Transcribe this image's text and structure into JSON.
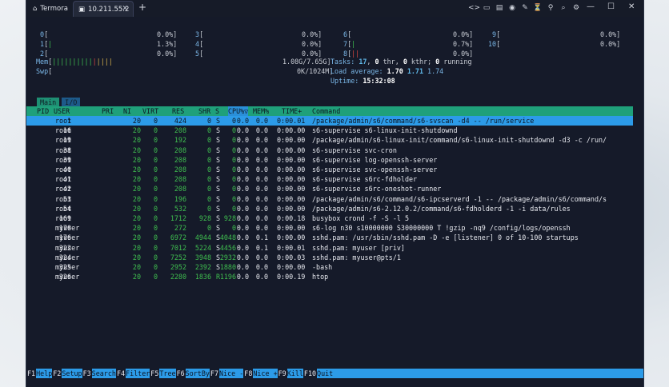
{
  "titlebar": {
    "home_tab": "Termora",
    "active_tab": "10.211.55.2",
    "new_tab": "+",
    "icons": [
      "code-icon",
      "folder-icon",
      "clipboard-icon",
      "record-icon",
      "pen-icon",
      "filter-icon",
      "network-icon",
      "zoom-icon",
      "settings-icon"
    ],
    "icon_glyphs": [
      "<>",
      "▭",
      "▤",
      "◉",
      "✎",
      "⏳",
      "⚲",
      "⌕",
      "⚙"
    ],
    "minimize": "—",
    "maximize": "☐",
    "close": "✕"
  },
  "cpus": [
    {
      "id": "0",
      "pct": "0.0%"
    },
    {
      "id": "1",
      "pct": "1.3%",
      "bar": "|"
    },
    {
      "id": "2",
      "pct": "0.0%"
    },
    {
      "id": "3",
      "pct": "0.0%"
    },
    {
      "id": "4",
      "pct": "0.0%"
    },
    {
      "id": "5",
      "pct": "0.0%"
    },
    {
      "id": "6",
      "pct": "0.0%"
    },
    {
      "id": "7",
      "pct": "0.7%",
      "bar": "|"
    },
    {
      "id": "8",
      "pct": "0.0%",
      "bar": "||"
    },
    {
      "id": "9",
      "pct": "0.0%"
    },
    {
      "id": "10",
      "pct": "0.0%"
    }
  ],
  "mem": {
    "label": "Mem",
    "bar_green": "||||||||||",
    "bar_red": "|",
    "bar_yellow": "||||",
    "value": "1.08G/7.65G"
  },
  "swp": {
    "label": "Swp",
    "value": "0K/1024M"
  },
  "tasks": {
    "label": "Tasks:",
    "count": "17",
    "thr": "0",
    "thr_label": "thr,",
    "kthr": "0",
    "kthr_label": "kthr;",
    "running": "0",
    "running_label": "running"
  },
  "load": {
    "label": "Load average:",
    "l1": "1.70",
    "l5": "1.71",
    "l15": "1.74"
  },
  "uptime": {
    "label": "Uptime:",
    "value": "15:32:08"
  },
  "screen_tabs": [
    "Main",
    "I/O"
  ],
  "columns": [
    "PID",
    "USER",
    "PRI",
    "NI",
    "VIRT",
    "RES",
    "SHR",
    "S",
    "CPU%▽",
    "MEM%",
    "TIME+",
    "Command"
  ],
  "processes": [
    {
      "pid": "1",
      "user": "root",
      "pri": "20",
      "ni": "0",
      "virt": "424",
      "res": "0",
      "shr": "0",
      "s": "S",
      "cpu": "0.0",
      "mem": "0.0",
      "time": "0:00.01",
      "cmd": "/package/admin/s6/command/s6-svscan -d4 -- /run/service"
    },
    {
      "pid": "16",
      "user": "root",
      "pri": "20",
      "ni": "0",
      "virt": "208",
      "res": "0",
      "shr": "0",
      "s": "S",
      "cpu": "0.0",
      "mem": "0.0",
      "time": "0:00.00",
      "cmd": "s6-supervise s6-linux-init-shutdownd"
    },
    {
      "pid": "19",
      "user": "root",
      "pri": "20",
      "ni": "0",
      "virt": "192",
      "res": "0",
      "shr": "0",
      "s": "S",
      "cpu": "0.0",
      "mem": "0.0",
      "time": "0:00.00",
      "cmd": "/package/admin/s6-linux-init/command/s6-linux-init-shutdownd -d3 -c /run/"
    },
    {
      "pid": "38",
      "user": "root",
      "pri": "20",
      "ni": "0",
      "virt": "208",
      "res": "0",
      "shr": "0",
      "s": "S",
      "cpu": "0.0",
      "mem": "0.0",
      "time": "0:00.00",
      "cmd": "s6-supervise svc-cron"
    },
    {
      "pid": "39",
      "user": "root",
      "pri": "20",
      "ni": "0",
      "virt": "208",
      "res": "0",
      "shr": "0",
      "s": "S",
      "cpu": "0.0",
      "mem": "0.0",
      "time": "0:00.00",
      "cmd": "s6-supervise log-openssh-server"
    },
    {
      "pid": "40",
      "user": "root",
      "pri": "20",
      "ni": "0",
      "virt": "208",
      "res": "0",
      "shr": "0",
      "s": "S",
      "cpu": "0.0",
      "mem": "0.0",
      "time": "0:00.00",
      "cmd": "s6-supervise svc-openssh-server"
    },
    {
      "pid": "41",
      "user": "root",
      "pri": "20",
      "ni": "0",
      "virt": "208",
      "res": "0",
      "shr": "0",
      "s": "S",
      "cpu": "0.0",
      "mem": "0.0",
      "time": "0:00.00",
      "cmd": "s6-supervise s6rc-fdholder"
    },
    {
      "pid": "42",
      "user": "root",
      "pri": "20",
      "ni": "0",
      "virt": "208",
      "res": "0",
      "shr": "0",
      "s": "S",
      "cpu": "0.0",
      "mem": "0.0",
      "time": "0:00.00",
      "cmd": "s6-supervise s6rc-oneshot-runner"
    },
    {
      "pid": "53",
      "user": "root",
      "pri": "20",
      "ni": "0",
      "virt": "196",
      "res": "0",
      "shr": "0",
      "s": "S",
      "cpu": "0.0",
      "mem": "0.0",
      "time": "0:00.00",
      "cmd": "/package/admin/s6/command/s6-ipcserverd -1 -- /package/admin/s6/command/s"
    },
    {
      "pid": "54",
      "user": "root",
      "pri": "20",
      "ni": "0",
      "virt": "532",
      "res": "0",
      "shr": "0",
      "s": "S",
      "cpu": "0.0",
      "mem": "0.0",
      "time": "0:00.00",
      "cmd": "/package/admin/s6-2.12.0.2/command/s6-fdholderd -1 -i data/rules"
    },
    {
      "pid": "169",
      "user": "root",
      "pri": "20",
      "ni": "0",
      "virt": "1712",
      "res": "928",
      "shr": "928",
      "s": "S",
      "cpu": "0.0",
      "mem": "0.0",
      "time": "0:00.18",
      "cmd": "busybox crond -f -S -l 5"
    },
    {
      "pid": "170",
      "user": "myuser",
      "pri": "20",
      "ni": "0",
      "virt": "272",
      "res": "0",
      "shr": "0",
      "s": "S",
      "cpu": "0.0",
      "mem": "0.0",
      "time": "0:00.00",
      "cmd": "s6-log n30 s10000000 S30000000 T !gzip -nq9 /config/logs/openssh"
    },
    {
      "pid": "176",
      "user": "myuser",
      "pri": "20",
      "ni": "0",
      "virt": "6972",
      "res": "4944",
      "shr": "4048",
      "s": "S",
      "cpu": "0.0",
      "mem": "0.1",
      "time": "0:00.00",
      "cmd": "sshd.pam: /usr/sbin/sshd.pam -D -e [listener] 0 of 10-100 startups"
    },
    {
      "pid": "322",
      "user": "myuser",
      "pri": "20",
      "ni": "0",
      "virt": "7012",
      "res": "5224",
      "shr": "4456",
      "s": "S",
      "cpu": "0.0",
      "mem": "0.1",
      "time": "0:00.01",
      "cmd": "sshd.pam: myuser [priv]"
    },
    {
      "pid": "324",
      "user": "myuser",
      "pri": "20",
      "ni": "0",
      "virt": "7252",
      "res": "3948",
      "shr": "2932",
      "s": "S",
      "cpu": "0.0",
      "mem": "0.0",
      "time": "0:00.03",
      "cmd": "sshd.pam: myuser@pts/1"
    },
    {
      "pid": "325",
      "user": "myuser",
      "pri": "20",
      "ni": "0",
      "virt": "2952",
      "res": "2392",
      "shr": "1880",
      "s": "S",
      "cpu": "0.0",
      "mem": "0.0",
      "time": "0:00.00",
      "cmd": "-bash"
    },
    {
      "pid": "326",
      "user": "myuser",
      "pri": "20",
      "ni": "0",
      "virt": "2280",
      "res": "1836",
      "shr": "1196",
      "s": "R",
      "cpu": "0.0",
      "mem": "0.0",
      "time": "0:00.19",
      "cmd": "htop"
    }
  ],
  "fkeys": [
    {
      "key": "F1",
      "label": "Help  "
    },
    {
      "key": "F2",
      "label": "Setup "
    },
    {
      "key": "F3",
      "label": "Search"
    },
    {
      "key": "F4",
      "label": "Filter"
    },
    {
      "key": "F5",
      "label": "Tree  "
    },
    {
      "key": "F6",
      "label": "SortBy"
    },
    {
      "key": "F7",
      "label": "Nice -"
    },
    {
      "key": "F8",
      "label": "Nice +"
    },
    {
      "key": "F9",
      "label": "Kill  "
    },
    {
      "key": "F10",
      "label": "Quit"
    }
  ]
}
